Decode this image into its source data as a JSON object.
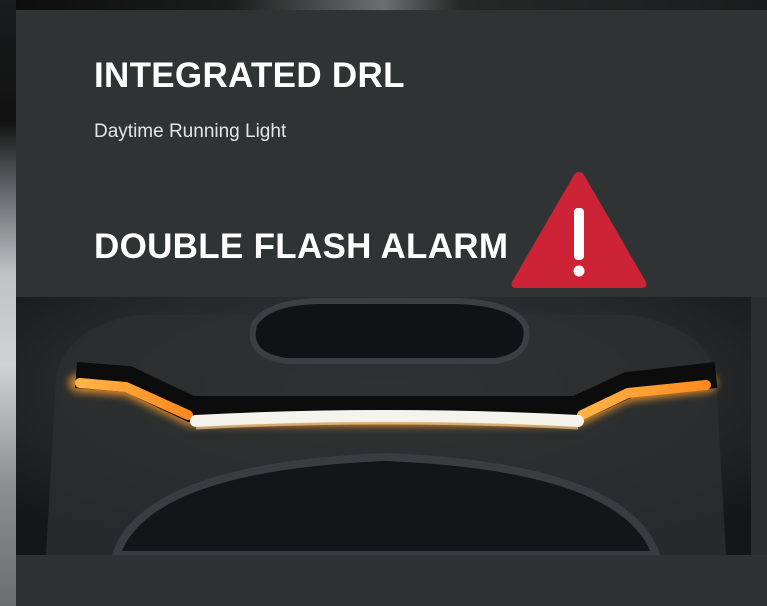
{
  "feature": {
    "title": "INTEGRATED DRL",
    "subtitle": "Daytime Running Light"
  },
  "alarm": {
    "title": "DOUBLE FLASH ALARM",
    "icon": "warning-triangle-icon",
    "icon_color": "#cc2436"
  },
  "photo": {
    "subject": "rear-light-bar-photo",
    "light_color_amber": "#ff9c2a",
    "light_color_white": "#f4f4ec"
  }
}
